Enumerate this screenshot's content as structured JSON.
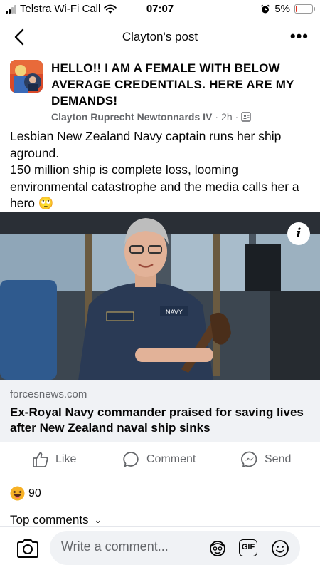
{
  "status_bar": {
    "carrier": "Telstra Wi-Fi Call",
    "time": "07:07",
    "battery_percent": "5%",
    "battery_level": 0.05,
    "wifi_icon": "wifi-icon",
    "alarm_icon": "alarm-icon"
  },
  "nav": {
    "title": "Clayton's post",
    "back_icon": "chevron-left-icon",
    "more_icon": "more-horizontal-icon",
    "more_label": "•••"
  },
  "post": {
    "title": "HELLO!! I AM A FEMALE WITH BELOW AVERAGE CREDENTIALS. HERE ARE MY DEMANDS!",
    "author": "Clayton Ruprecht Newtonnards IV",
    "separator": "·",
    "time": "2h",
    "audience_icon": "friends-list-icon",
    "body": "Lesbian New Zealand Navy captain runs her ship aground.\n150 million ship is complete loss, looming environmental catastrophe and the media calls her a hero 🙄"
  },
  "link": {
    "info_label": "i",
    "domain": "forcesnews.com",
    "headline": "Ex-Royal Navy commander praised for saving lives after New Zealand naval ship sinks",
    "image_badge_text": "NAVY"
  },
  "actions": {
    "like": "Like",
    "comment": "Comment",
    "send": "Send"
  },
  "reactions": {
    "emoji": "laughing-emoji",
    "count": "90"
  },
  "comments": {
    "header": "Top comments",
    "chevron": "⌄"
  },
  "composer": {
    "placeholder": "Write a comment...",
    "gif_label": "GIF"
  },
  "colors": {
    "text_primary": "#050505",
    "text_secondary": "#65676b",
    "link_bg": "#f0f2f5",
    "divider": "#e4e6eb",
    "battery_low": "#e0301e"
  }
}
